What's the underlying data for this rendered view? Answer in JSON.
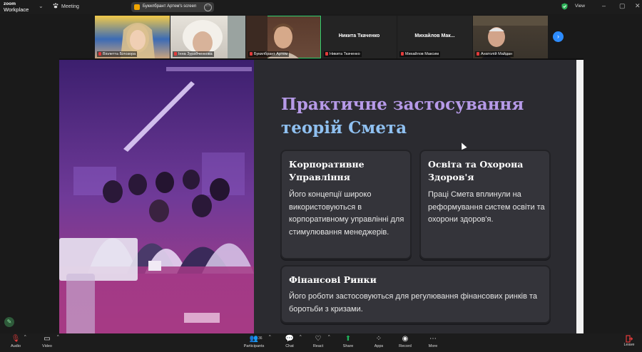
{
  "titlebar": {
    "logo_line1": "zoom",
    "logo_line2": "Workplace",
    "chevron_icon": "chevron-down-icon",
    "meeting_label": "Meeting",
    "share_label": "Букилбрант Артем's screen",
    "view_label": "View",
    "minimize": "–",
    "maximize": "▢",
    "close": "✕"
  },
  "participants": [
    {
      "name": "Віолетта Білозора",
      "muted": true
    },
    {
      "name": "Інна Зурабченкова",
      "muted": true
    },
    {
      "name": "Букилбрант Артем",
      "muted": true,
      "active": true
    },
    {
      "name": "Никита Ткаченко",
      "muted": true,
      "big": "Никита Ткаченко"
    },
    {
      "name": "Михайлов Максим",
      "muted": true,
      "big": "Михайлов Мак..."
    },
    {
      "name": "Анатолій Майдан",
      "muted": true
    }
  ],
  "slide": {
    "title_line1": "Практичне застосування",
    "title_line2": "теорій Смета",
    "cards": [
      {
        "title": "Корпоративне Управління",
        "body": "Його концепції широко використовуються в корпоративному управлінні для стимулювання менеджерів."
      },
      {
        "title": "Освіта та Охорона Здоров'я",
        "body": "Праці Смета вплинули на реформування систем освіти та охорони здоров'я."
      },
      {
        "title": "Фінансові Ринки",
        "body": "Його роботи застосовуються для регулювання фінансових ринків та боротьби з кризами."
      }
    ]
  },
  "toolbar": {
    "audio": "Audio",
    "video": "Video",
    "participants": "Participants",
    "participants_count": "36",
    "chat": "Chat",
    "react": "React",
    "share": "Share",
    "apps": "Apps",
    "record": "Record",
    "more": "More",
    "leave": "Leave"
  },
  "colors": {
    "active_tile_border": "#2fd06e",
    "title_purple": "#b69ae8",
    "title_blue": "#8fc0f0",
    "share_green": "#1fb25a",
    "leave_red": "#e23b3b"
  }
}
